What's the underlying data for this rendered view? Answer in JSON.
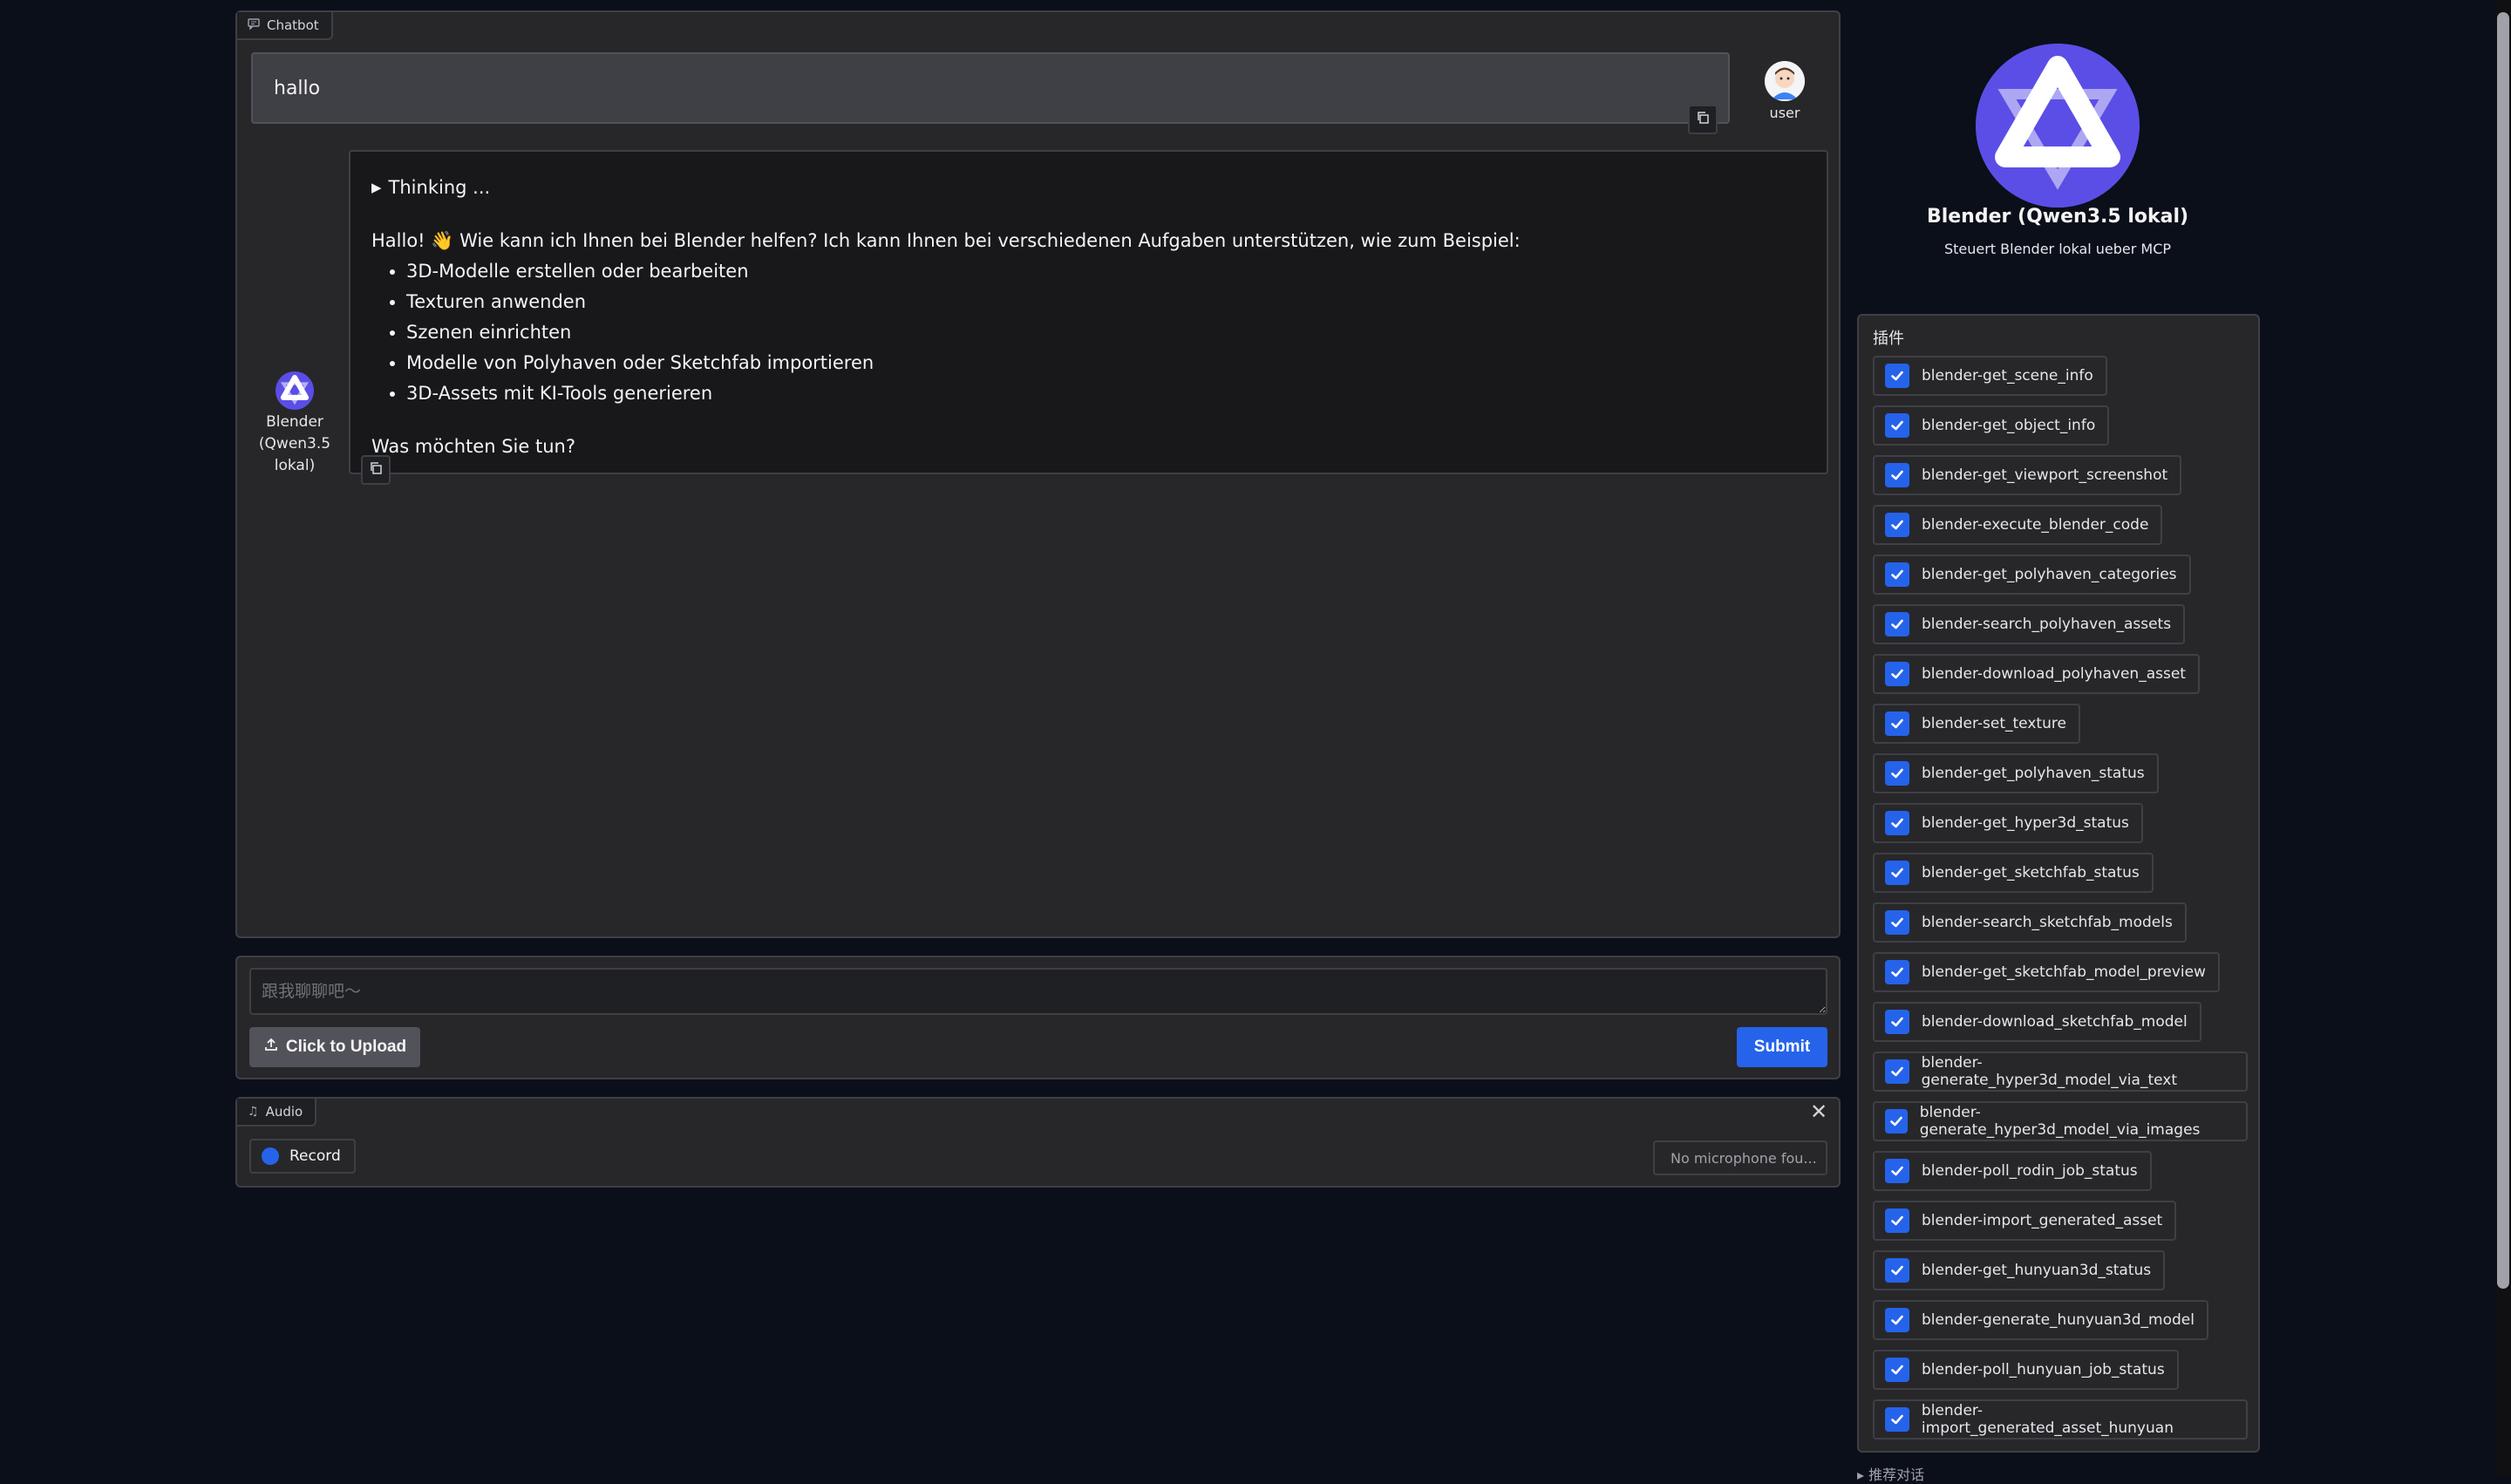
{
  "chatbot": {
    "label": "Chatbot",
    "user": {
      "name": "user",
      "message": "hallo"
    },
    "bot": {
      "name": "Blender (Qwen3.5 lokal)",
      "thinking": "Thinking ...",
      "intro": "Hallo! 👋 Wie kann ich Ihnen bei Blender helfen? Ich kann Ihnen bei verschiedenen Aufgaben unterstützen, wie zum Beispiel:",
      "bullets": [
        "3D-Modelle erstellen oder bearbeiten",
        "Texturen anwenden",
        "Szenen einrichten",
        "Modelle von Polyhaven oder Sketchfab importieren",
        "3D-Assets mit KI-Tools generieren"
      ],
      "outro": "Was möchten Sie tun?"
    }
  },
  "input": {
    "placeholder": "跟我聊聊吧～",
    "upload_label": "Click to Upload",
    "submit_label": "Submit"
  },
  "audio": {
    "label": "Audio",
    "record_label": "Record",
    "mic_status": "No microphone fou..."
  },
  "agent": {
    "name": "Blender (Qwen3.5 lokal)",
    "description": "Steuert Blender lokal ueber MCP"
  },
  "plugins": {
    "label": "插件",
    "items": [
      {
        "name": "blender-get_scene_info",
        "checked": true
      },
      {
        "name": "blender-get_object_info",
        "checked": true
      },
      {
        "name": "blender-get_viewport_screenshot",
        "checked": true
      },
      {
        "name": "blender-execute_blender_code",
        "checked": true
      },
      {
        "name": "blender-get_polyhaven_categories",
        "checked": true
      },
      {
        "name": "blender-search_polyhaven_assets",
        "checked": true
      },
      {
        "name": "blender-download_polyhaven_asset",
        "checked": true
      },
      {
        "name": "blender-set_texture",
        "checked": true
      },
      {
        "name": "blender-get_polyhaven_status",
        "checked": true
      },
      {
        "name": "blender-get_hyper3d_status",
        "checked": true
      },
      {
        "name": "blender-get_sketchfab_status",
        "checked": true
      },
      {
        "name": "blender-search_sketchfab_models",
        "checked": true
      },
      {
        "name": "blender-get_sketchfab_model_preview",
        "checked": true
      },
      {
        "name": "blender-download_sketchfab_model",
        "checked": true
      },
      {
        "name": "blender-generate_hyper3d_model_via_text",
        "checked": true
      },
      {
        "name": "blender-generate_hyper3d_model_via_images",
        "checked": true
      },
      {
        "name": "blender-poll_rodin_job_status",
        "checked": true
      },
      {
        "name": "blender-import_generated_asset",
        "checked": true
      },
      {
        "name": "blender-get_hunyuan3d_status",
        "checked": true
      },
      {
        "name": "blender-generate_hunyuan3d_model",
        "checked": true
      },
      {
        "name": "blender-poll_hunyuan_job_status",
        "checked": true
      },
      {
        "name": "blender-import_generated_asset_hunyuan",
        "checked": true
      }
    ]
  },
  "footer_cut": "▸ 推荐对话",
  "colors": {
    "background": "#0b0f19",
    "panel": "#27272a",
    "accent": "#2563eb"
  }
}
